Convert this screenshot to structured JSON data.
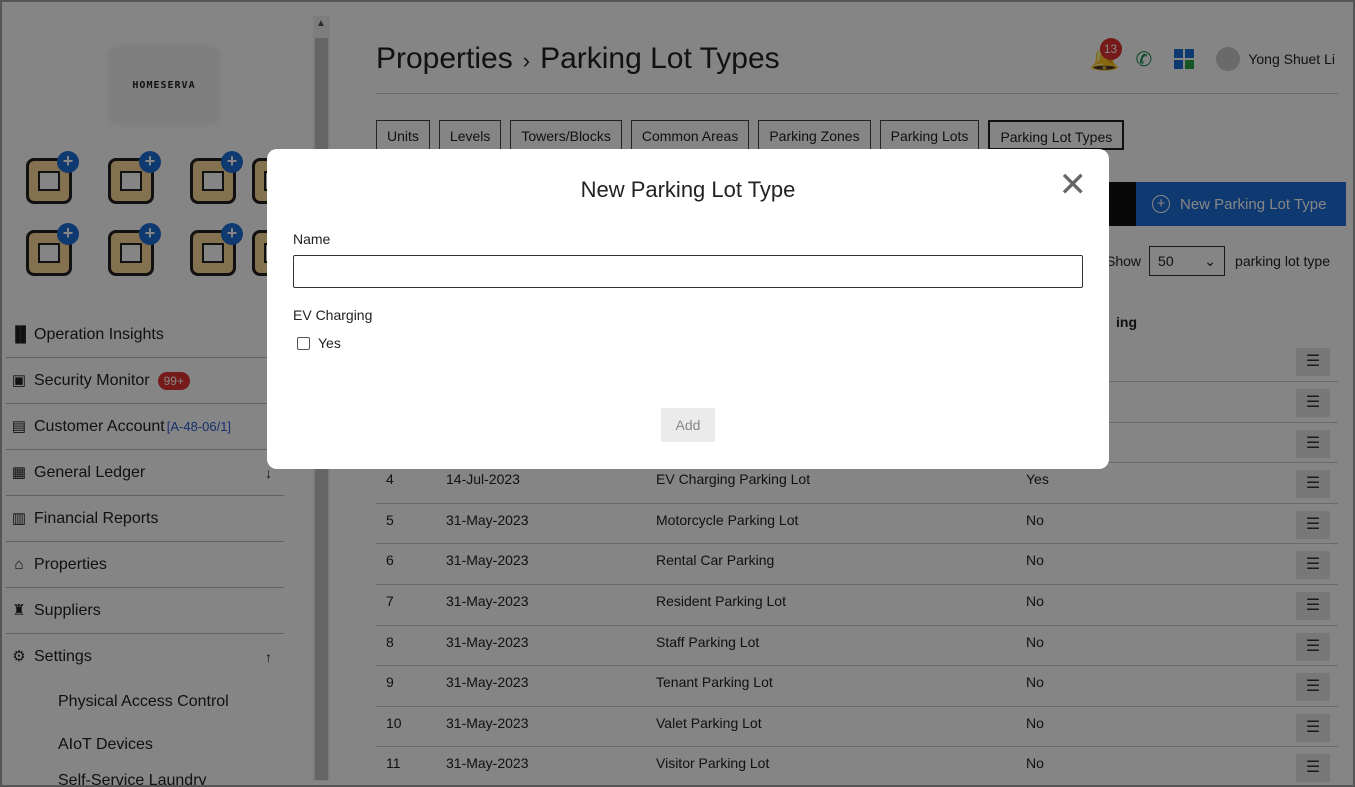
{
  "brand": {
    "logo_text": "HOMESERVA"
  },
  "sidebar": {
    "nav": [
      {
        "label": "Operation Insights",
        "icon": "bar-chart-icon"
      },
      {
        "label": "Security Monitor",
        "icon": "monitor-icon",
        "badge": "99+"
      },
      {
        "label": "Customer Account",
        "icon": "id-card-icon",
        "account": "[A-48-06/1]"
      },
      {
        "label": "General Ledger",
        "icon": "ledger-icon",
        "arrow": "↓"
      },
      {
        "label": "Financial Reports",
        "icon": "report-icon"
      },
      {
        "label": "Properties",
        "icon": "home-icon"
      },
      {
        "label": "Suppliers",
        "icon": "supplier-icon"
      },
      {
        "label": "Settings",
        "icon": "gear-icon",
        "arrow": "↑"
      }
    ],
    "subnav": [
      "Physical Access Control",
      "AIoT Devices",
      "Self-Service Laundry"
    ]
  },
  "header": {
    "title_main": "Properties",
    "title_sep": "›",
    "title_sub": "Parking Lot Types",
    "notification_count": "13",
    "user_name": "Yong Shuet Li"
  },
  "tabs": [
    "Units",
    "Levels",
    "Towers/Blocks",
    "Common Areas",
    "Parking Zones",
    "Parking Lots",
    "Parking Lot Types"
  ],
  "actions": {
    "new_button": "New Parking Lot Type"
  },
  "list_controls": {
    "show_label": "Show",
    "page_size": "50",
    "after_label": "parking lot type"
  },
  "table": {
    "ev_header": "ing",
    "rows": [
      {
        "no": "",
        "date": "",
        "name": "",
        "ev": ""
      },
      {
        "no": "",
        "date": "",
        "name": "",
        "ev": ""
      },
      {
        "no": "",
        "date": "",
        "name": "",
        "ev": ""
      },
      {
        "no": "4",
        "date": "14-Jul-2023",
        "name": "EV Charging Parking Lot",
        "ev": "Yes"
      },
      {
        "no": "5",
        "date": "31-May-2023",
        "name": "Motorcycle Parking Lot",
        "ev": "No"
      },
      {
        "no": "6",
        "date": "31-May-2023",
        "name": "Rental Car Parking",
        "ev": "No"
      },
      {
        "no": "7",
        "date": "31-May-2023",
        "name": "Resident Parking Lot",
        "ev": "No"
      },
      {
        "no": "8",
        "date": "31-May-2023",
        "name": "Staff Parking Lot",
        "ev": "No"
      },
      {
        "no": "9",
        "date": "31-May-2023",
        "name": "Tenant Parking Lot",
        "ev": "No"
      },
      {
        "no": "10",
        "date": "31-May-2023",
        "name": "Valet Parking Lot",
        "ev": "No"
      },
      {
        "no": "11",
        "date": "31-May-2023",
        "name": "Visitor Parking Lot",
        "ev": "No"
      }
    ]
  },
  "modal": {
    "title": "New Parking Lot Type",
    "name_label": "Name",
    "name_value": "",
    "ev_label": "EV Charging",
    "checkbox_label": "Yes",
    "add_button": "Add"
  }
}
